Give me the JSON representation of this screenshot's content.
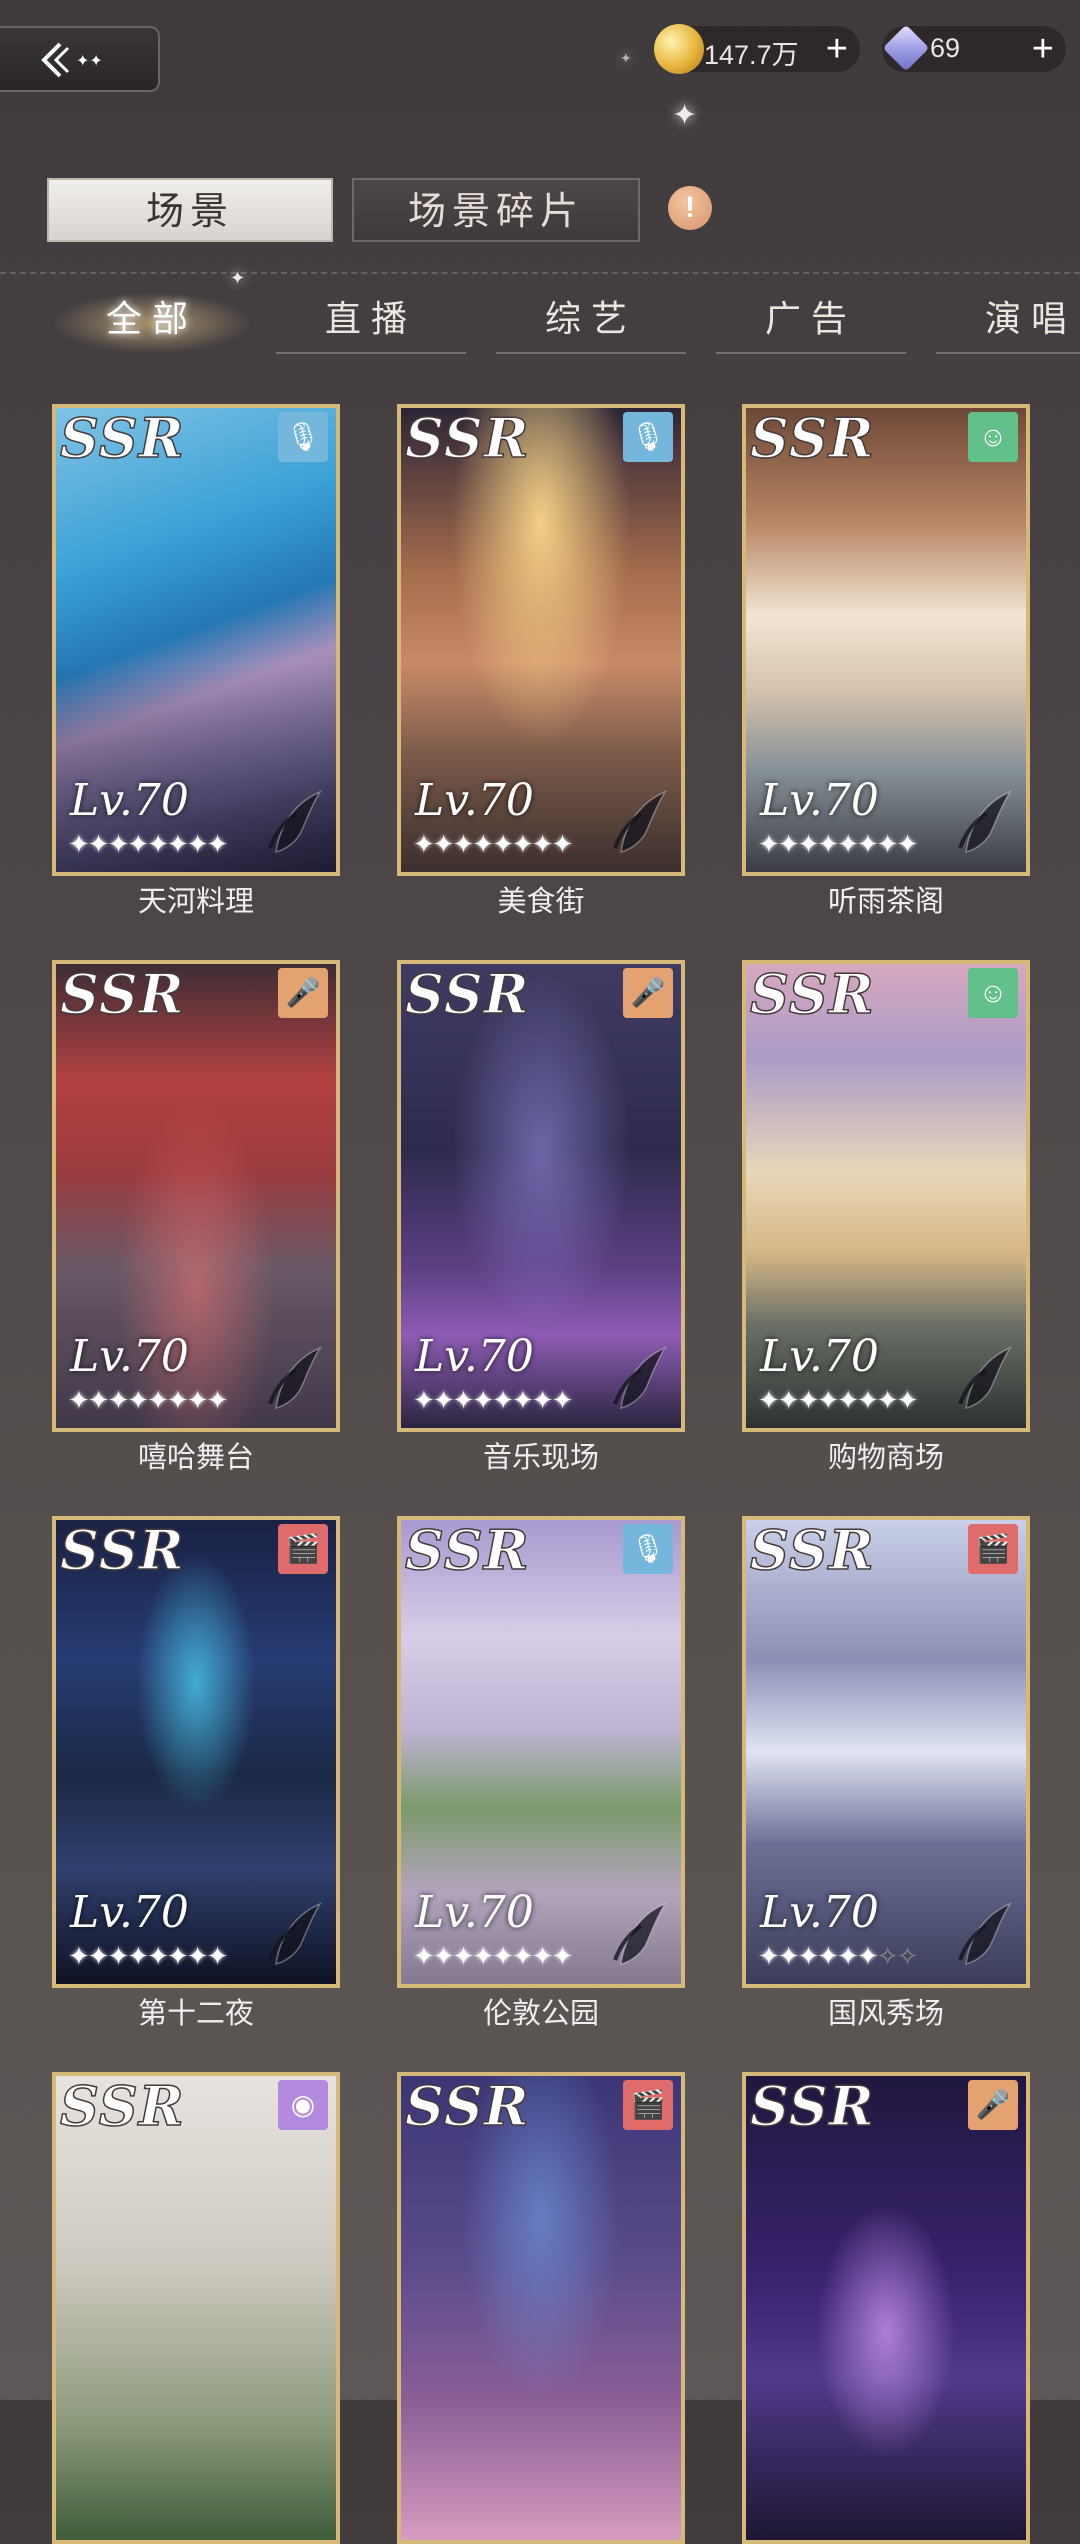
{
  "header": {
    "back_icon": "back-arrow-icon",
    "coins": {
      "icon": "coin-icon",
      "value": "147.7万",
      "add_label": "+"
    },
    "gems": {
      "icon": "gem-icon",
      "value": "69",
      "add_label": "+"
    }
  },
  "tabs": [
    {
      "label": "场景",
      "active": true
    },
    {
      "label": "场景碎片",
      "active": false
    }
  ],
  "info_label": "!",
  "filters": [
    {
      "label": "全部",
      "active": true
    },
    {
      "label": "直播",
      "active": false
    },
    {
      "label": "综艺",
      "active": false
    },
    {
      "label": "广告",
      "active": false
    },
    {
      "label": "演唱",
      "active": false
    }
  ],
  "cards": [
    {
      "rarity": "SSR",
      "level": "Lv.70",
      "name": "天河料理",
      "badge": "mic-icon",
      "stars": 8
    },
    {
      "rarity": "SSR",
      "level": "Lv.70",
      "name": "美食街",
      "badge": "mic-icon",
      "stars": 8
    },
    {
      "rarity": "SSR",
      "level": "Lv.70",
      "name": "听雨茶阁",
      "badge": "smile-icon",
      "stars": 8
    },
    {
      "rarity": "SSR",
      "level": "Lv.70",
      "name": "嘻哈舞台",
      "badge": "handheld-mic-icon",
      "stars": 8
    },
    {
      "rarity": "SSR",
      "level": "Lv.70",
      "name": "音乐现场",
      "badge": "handheld-mic-icon",
      "stars": 8
    },
    {
      "rarity": "SSR",
      "level": "Lv.70",
      "name": "购物商场",
      "badge": "smile-icon",
      "stars": 8
    },
    {
      "rarity": "SSR",
      "level": "Lv.70",
      "name": "第十二夜",
      "badge": "clapperboard-icon",
      "stars": 8
    },
    {
      "rarity": "SSR",
      "level": "Lv.70",
      "name": "伦敦公园",
      "badge": "mic-icon",
      "stars": 8
    },
    {
      "rarity": "SSR",
      "level": "Lv.70",
      "name": "国风秀场",
      "badge": "clapperboard-icon",
      "stars": 6
    },
    {
      "rarity": "SSR",
      "badge": "camera-icon"
    },
    {
      "rarity": "SSR",
      "badge": "clapperboard-icon"
    },
    {
      "rarity": "SSR",
      "badge": "handheld-mic-icon"
    }
  ]
}
